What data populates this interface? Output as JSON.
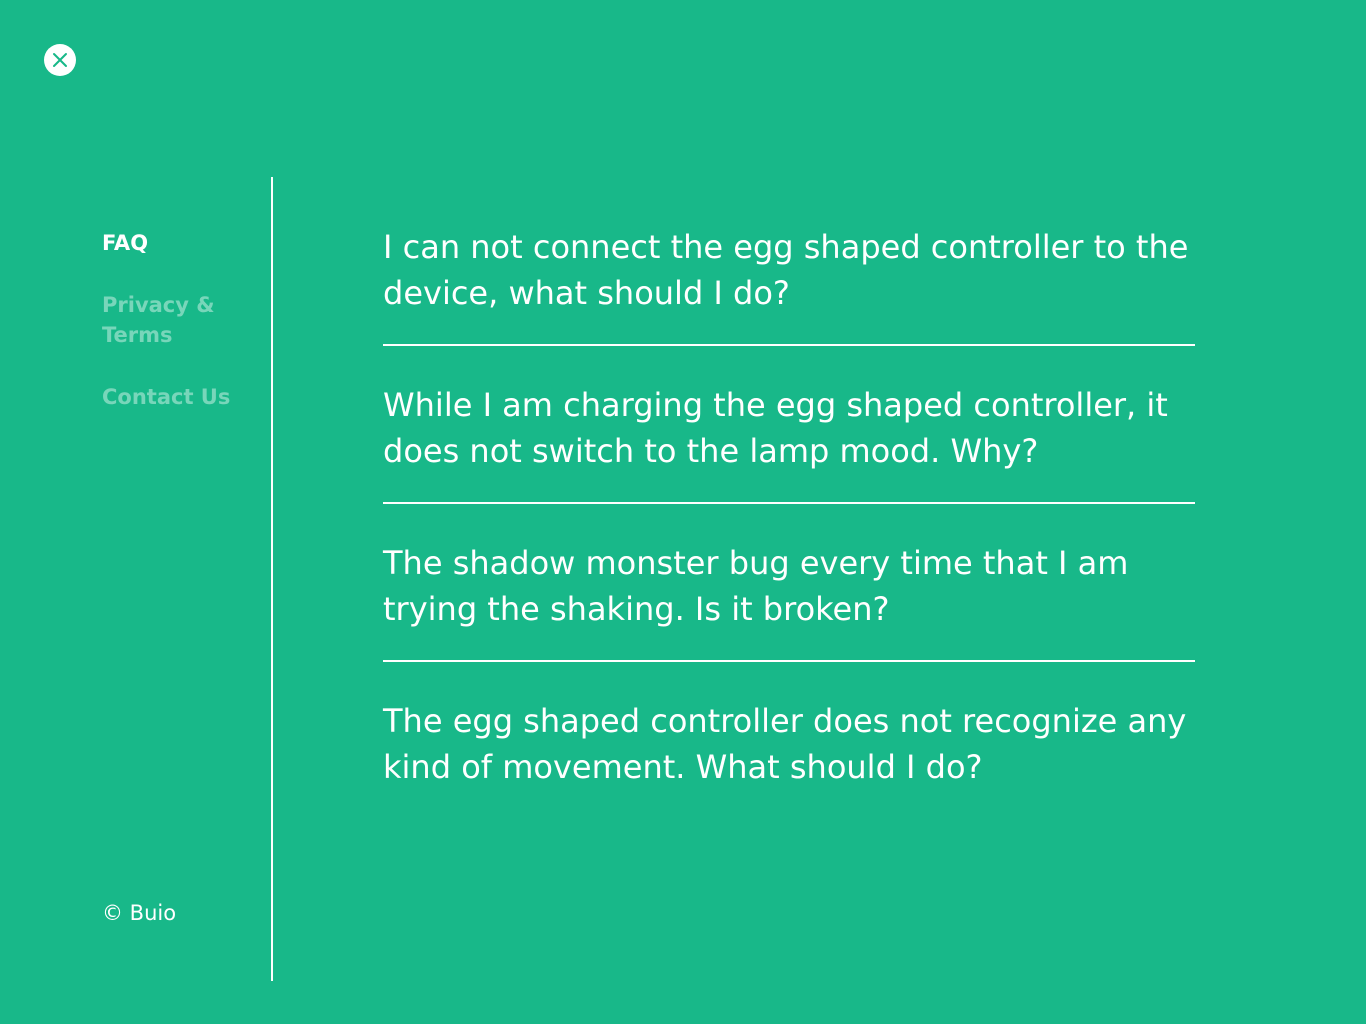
{
  "close_icon": "close-icon",
  "nav": {
    "faq": "FAQ",
    "privacy": "Privacy & Terms",
    "contact": "Contact Us"
  },
  "copyright": "© Buio",
  "faq": [
    "I can not connect the egg shaped controller to the device, what should I do?",
    "While I am charging the egg shaped controller, it does not switch to the lamp mood. Why?",
    "The shadow monster bug every time that I am trying the shaking. Is it broken?",
    "The egg shaped controller does not recognize any kind of movement. What should I do?"
  ],
  "colors": {
    "background": "#18b889",
    "text": "#ffffff",
    "nav_inactive": "rgba(255,255,255,0.42)"
  }
}
